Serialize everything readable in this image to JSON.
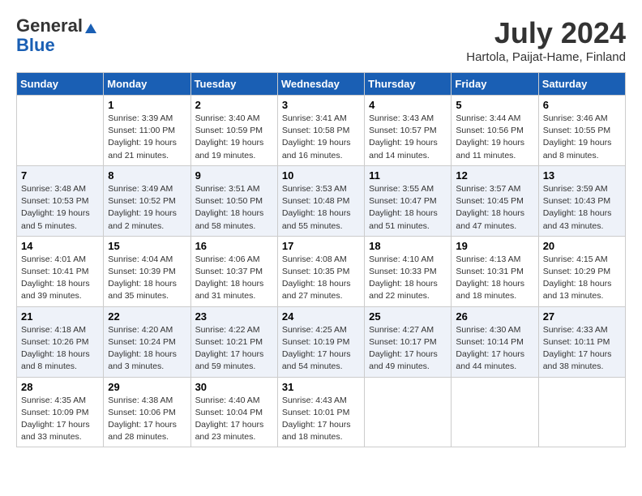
{
  "logo": {
    "general": "General",
    "blue": "Blue"
  },
  "title": "July 2024",
  "subtitle": "Hartola, Paijat-Hame, Finland",
  "days_of_week": [
    "Sunday",
    "Monday",
    "Tuesday",
    "Wednesday",
    "Thursday",
    "Friday",
    "Saturday"
  ],
  "weeks": [
    [
      {
        "day": null
      },
      {
        "day": "1",
        "sunrise": "Sunrise: 3:39 AM",
        "sunset": "Sunset: 11:00 PM",
        "daylight": "Daylight: 19 hours and 21 minutes."
      },
      {
        "day": "2",
        "sunrise": "Sunrise: 3:40 AM",
        "sunset": "Sunset: 10:59 PM",
        "daylight": "Daylight: 19 hours and 19 minutes."
      },
      {
        "day": "3",
        "sunrise": "Sunrise: 3:41 AM",
        "sunset": "Sunset: 10:58 PM",
        "daylight": "Daylight: 19 hours and 16 minutes."
      },
      {
        "day": "4",
        "sunrise": "Sunrise: 3:43 AM",
        "sunset": "Sunset: 10:57 PM",
        "daylight": "Daylight: 19 hours and 14 minutes."
      },
      {
        "day": "5",
        "sunrise": "Sunrise: 3:44 AM",
        "sunset": "Sunset: 10:56 PM",
        "daylight": "Daylight: 19 hours and 11 minutes."
      },
      {
        "day": "6",
        "sunrise": "Sunrise: 3:46 AM",
        "sunset": "Sunset: 10:55 PM",
        "daylight": "Daylight: 19 hours and 8 minutes."
      }
    ],
    [
      {
        "day": "7",
        "sunrise": "Sunrise: 3:48 AM",
        "sunset": "Sunset: 10:53 PM",
        "daylight": "Daylight: 19 hours and 5 minutes."
      },
      {
        "day": "8",
        "sunrise": "Sunrise: 3:49 AM",
        "sunset": "Sunset: 10:52 PM",
        "daylight": "Daylight: 19 hours and 2 minutes."
      },
      {
        "day": "9",
        "sunrise": "Sunrise: 3:51 AM",
        "sunset": "Sunset: 10:50 PM",
        "daylight": "Daylight: 18 hours and 58 minutes."
      },
      {
        "day": "10",
        "sunrise": "Sunrise: 3:53 AM",
        "sunset": "Sunset: 10:48 PM",
        "daylight": "Daylight: 18 hours and 55 minutes."
      },
      {
        "day": "11",
        "sunrise": "Sunrise: 3:55 AM",
        "sunset": "Sunset: 10:47 PM",
        "daylight": "Daylight: 18 hours and 51 minutes."
      },
      {
        "day": "12",
        "sunrise": "Sunrise: 3:57 AM",
        "sunset": "Sunset: 10:45 PM",
        "daylight": "Daylight: 18 hours and 47 minutes."
      },
      {
        "day": "13",
        "sunrise": "Sunrise: 3:59 AM",
        "sunset": "Sunset: 10:43 PM",
        "daylight": "Daylight: 18 hours and 43 minutes."
      }
    ],
    [
      {
        "day": "14",
        "sunrise": "Sunrise: 4:01 AM",
        "sunset": "Sunset: 10:41 PM",
        "daylight": "Daylight: 18 hours and 39 minutes."
      },
      {
        "day": "15",
        "sunrise": "Sunrise: 4:04 AM",
        "sunset": "Sunset: 10:39 PM",
        "daylight": "Daylight: 18 hours and 35 minutes."
      },
      {
        "day": "16",
        "sunrise": "Sunrise: 4:06 AM",
        "sunset": "Sunset: 10:37 PM",
        "daylight": "Daylight: 18 hours and 31 minutes."
      },
      {
        "day": "17",
        "sunrise": "Sunrise: 4:08 AM",
        "sunset": "Sunset: 10:35 PM",
        "daylight": "Daylight: 18 hours and 27 minutes."
      },
      {
        "day": "18",
        "sunrise": "Sunrise: 4:10 AM",
        "sunset": "Sunset: 10:33 PM",
        "daylight": "Daylight: 18 hours and 22 minutes."
      },
      {
        "day": "19",
        "sunrise": "Sunrise: 4:13 AM",
        "sunset": "Sunset: 10:31 PM",
        "daylight": "Daylight: 18 hours and 18 minutes."
      },
      {
        "day": "20",
        "sunrise": "Sunrise: 4:15 AM",
        "sunset": "Sunset: 10:29 PM",
        "daylight": "Daylight: 18 hours and 13 minutes."
      }
    ],
    [
      {
        "day": "21",
        "sunrise": "Sunrise: 4:18 AM",
        "sunset": "Sunset: 10:26 PM",
        "daylight": "Daylight: 18 hours and 8 minutes."
      },
      {
        "day": "22",
        "sunrise": "Sunrise: 4:20 AM",
        "sunset": "Sunset: 10:24 PM",
        "daylight": "Daylight: 18 hours and 3 minutes."
      },
      {
        "day": "23",
        "sunrise": "Sunrise: 4:22 AM",
        "sunset": "Sunset: 10:21 PM",
        "daylight": "Daylight: 17 hours and 59 minutes."
      },
      {
        "day": "24",
        "sunrise": "Sunrise: 4:25 AM",
        "sunset": "Sunset: 10:19 PM",
        "daylight": "Daylight: 17 hours and 54 minutes."
      },
      {
        "day": "25",
        "sunrise": "Sunrise: 4:27 AM",
        "sunset": "Sunset: 10:17 PM",
        "daylight": "Daylight: 17 hours and 49 minutes."
      },
      {
        "day": "26",
        "sunrise": "Sunrise: 4:30 AM",
        "sunset": "Sunset: 10:14 PM",
        "daylight": "Daylight: 17 hours and 44 minutes."
      },
      {
        "day": "27",
        "sunrise": "Sunrise: 4:33 AM",
        "sunset": "Sunset: 10:11 PM",
        "daylight": "Daylight: 17 hours and 38 minutes."
      }
    ],
    [
      {
        "day": "28",
        "sunrise": "Sunrise: 4:35 AM",
        "sunset": "Sunset: 10:09 PM",
        "daylight": "Daylight: 17 hours and 33 minutes."
      },
      {
        "day": "29",
        "sunrise": "Sunrise: 4:38 AM",
        "sunset": "Sunset: 10:06 PM",
        "daylight": "Daylight: 17 hours and 28 minutes."
      },
      {
        "day": "30",
        "sunrise": "Sunrise: 4:40 AM",
        "sunset": "Sunset: 10:04 PM",
        "daylight": "Daylight: 17 hours and 23 minutes."
      },
      {
        "day": "31",
        "sunrise": "Sunrise: 4:43 AM",
        "sunset": "Sunset: 10:01 PM",
        "daylight": "Daylight: 17 hours and 18 minutes."
      },
      {
        "day": null
      },
      {
        "day": null
      },
      {
        "day": null
      }
    ]
  ]
}
